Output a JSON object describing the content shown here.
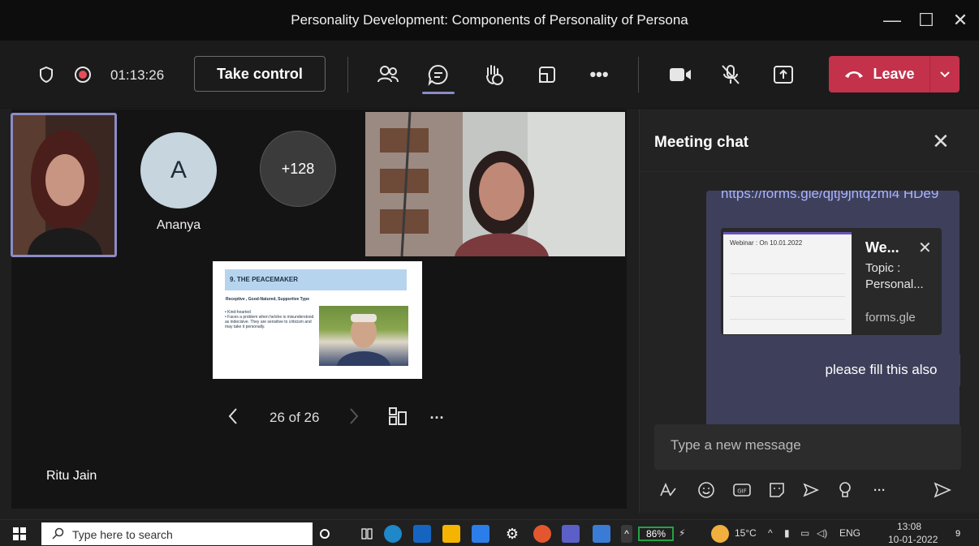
{
  "window": {
    "title": "Personality Development: Components of Personality of Persona"
  },
  "toolbar": {
    "timer": "01:13:26",
    "take_control": "Take control",
    "leave": "Leave",
    "icons": [
      "shield-icon",
      "record-icon",
      "people-icon",
      "chat-icon",
      "raise-hand-icon",
      "rooms-icon",
      "more-icon",
      "camera-icon",
      "mic-off-icon",
      "share-icon"
    ]
  },
  "stage": {
    "avatar_initial": "A",
    "avatar_name": "Ananya",
    "more_count": "+128",
    "slide": {
      "header": "9. THE PEACEMAKER",
      "subheading": "Receptive , Good-Natured, Supportive Type",
      "bullets": [
        "• Kind-hearted",
        "• Faces a problem when he/she is misunderstood as indecisive. They are sensitive to criticism and may take it personally."
      ]
    },
    "pager": "26 of 26",
    "presenter": "Ritu Jain"
  },
  "chat": {
    "title": "Meeting chat",
    "link_text": "https://forms.gle/qjtj9jhtqzmi4 HDe9",
    "card": {
      "title": "We...",
      "description": "Topic : Personal...",
      "domain": "forms.gle",
      "thumb_title": "Webinar : On 10.01.2022"
    },
    "message": "please fill this also",
    "input_placeholder": "Type a new message"
  },
  "taskbar": {
    "search_placeholder": "Type here to search",
    "battery": "86%",
    "weather": "15°C",
    "lang": "ENG",
    "time": "13:08",
    "date": "10-01-2022",
    "notifications": "9"
  },
  "colors": {
    "accent": "#8b8cc7",
    "leave": "#c4314b",
    "bubble": "#3e3f5a",
    "link": "#a9b5ff"
  }
}
